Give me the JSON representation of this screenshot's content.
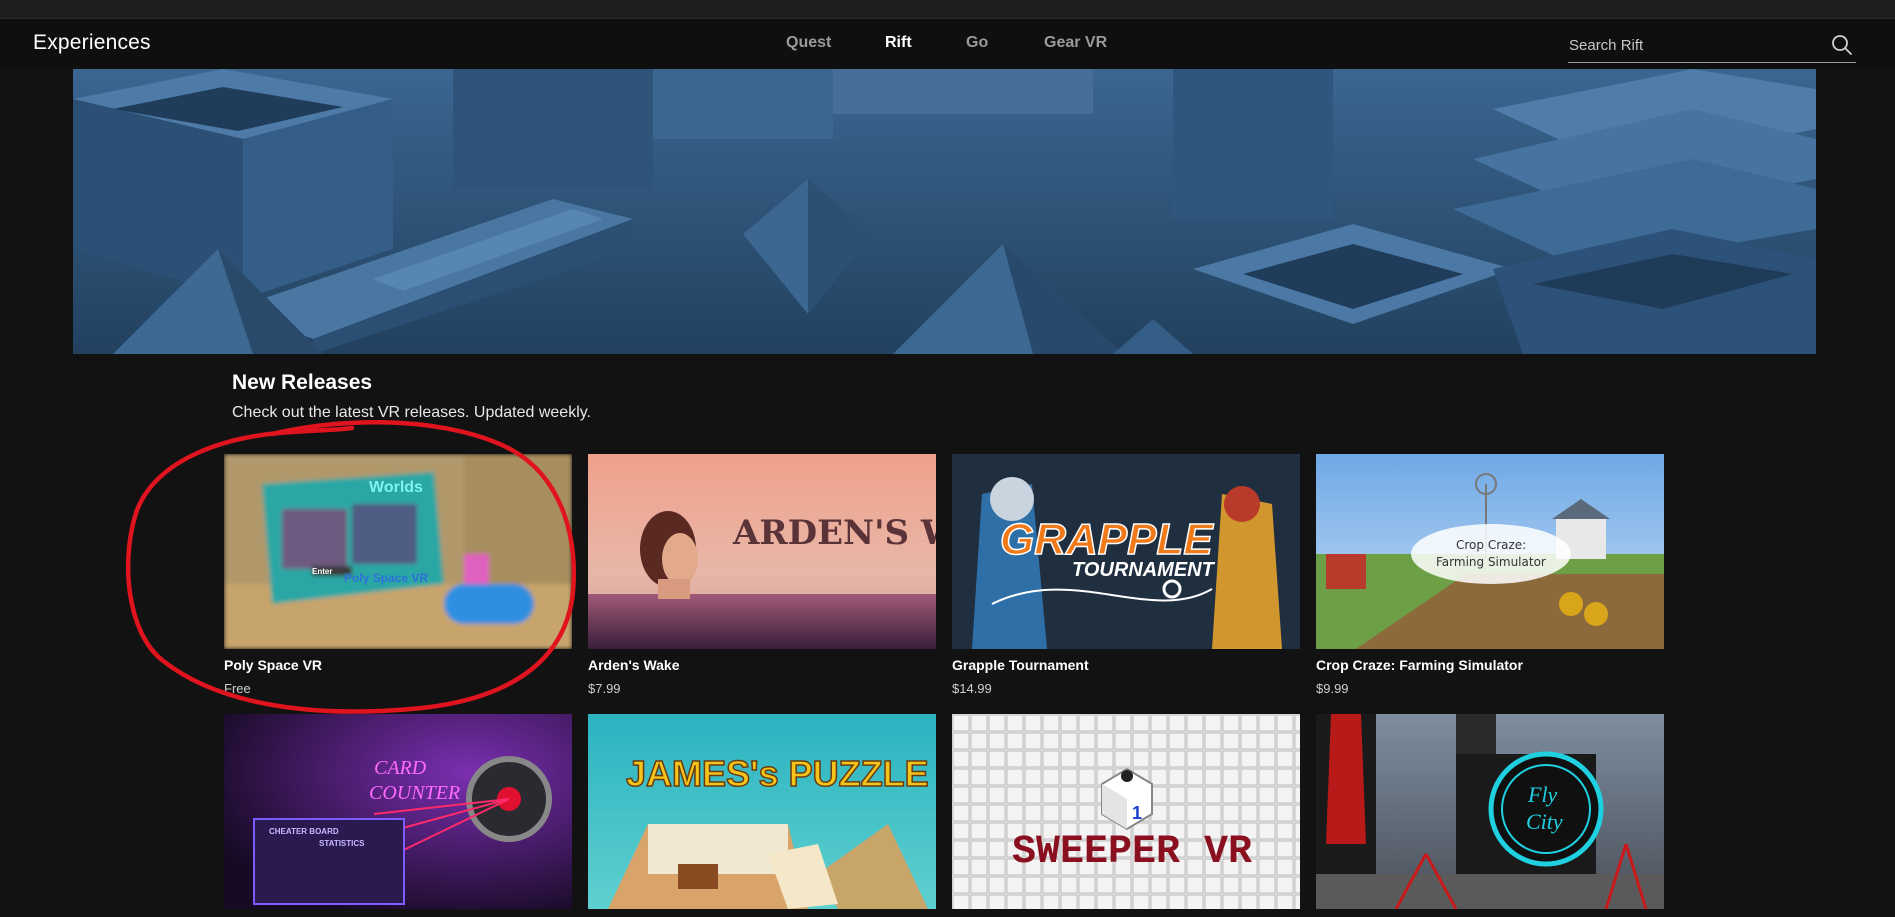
{
  "header": {
    "brand": "Experiences",
    "tabs": [
      {
        "label": "Quest",
        "active": false
      },
      {
        "label": "Rift",
        "active": true
      },
      {
        "label": "Go",
        "active": false
      },
      {
        "label": "Gear VR",
        "active": false
      }
    ],
    "search": {
      "placeholder": "Search Rift",
      "value": "",
      "icon": "search-icon"
    }
  },
  "section": {
    "title": "New Releases",
    "subtitle": "Check out the latest VR releases. Updated weekly."
  },
  "cards": [
    {
      "title": "Poly Space VR",
      "price": "Free",
      "art_text": [
        "Worlds",
        "Poly Space VR",
        "Enter"
      ]
    },
    {
      "title": "Arden's Wake",
      "price": "$7.99",
      "art_text": [
        "ARDEN'S WAKE"
      ]
    },
    {
      "title": "Grapple Tournament",
      "price": "$14.99",
      "art_text": [
        "GRAPPLE",
        "TOURNAMENT"
      ]
    },
    {
      "title": "Crop Craze: Farming Simulator",
      "price": "$9.99",
      "art_text": [
        "Crop Craze:",
        "Farming Simulator"
      ]
    },
    {
      "title": "",
      "price": "",
      "art_text": [
        "CARD",
        "COUNTER",
        "CHEATER BOARD",
        "STATISTICS"
      ]
    },
    {
      "title": "",
      "price": "",
      "art_text": [
        "JAMES's PUZZLE"
      ]
    },
    {
      "title": "",
      "price": "",
      "art_text": [
        "SWEEPER VR",
        "1"
      ]
    },
    {
      "title": "",
      "price": "",
      "art_text": [
        "Fly",
        "City"
      ]
    }
  ],
  "colors": {
    "background": "#121212",
    "navbar": "#0f0f0f",
    "annotation": "#e0141e",
    "muted_text": "#9a9a9a"
  }
}
